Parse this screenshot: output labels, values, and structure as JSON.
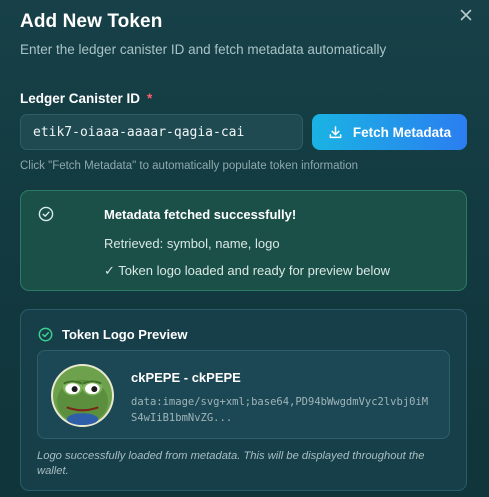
{
  "dialog": {
    "title": "Add New Token",
    "subtitle": "Enter the ledger canister ID and fetch metadata automatically",
    "close_icon": "close-icon"
  },
  "ledger_field": {
    "label": "Ledger Canister ID",
    "required_mark": "*",
    "value": "etik7-oiaaa-aaaar-qagia-cai",
    "hint": "Click \"Fetch Metadata\" to automatically populate token information"
  },
  "fetch_button": {
    "label": "Fetch Metadata",
    "icon": "download-icon"
  },
  "success": {
    "icon": "check-circle-icon",
    "title": "Metadata fetched successfully!",
    "retrieved": "Retrieved: symbol, name, logo",
    "logo_status": "✓ Token logo loaded and ready for preview below"
  },
  "preview": {
    "icon": "check-circle-icon",
    "title": "Token Logo Preview",
    "token_label": "ckPEPE - ckPEPE",
    "logo_data": "data:image/svg+xml;base64,PD94bWwgdmVyc2lvbj0iMS4wIiB1bmNvZG...",
    "note": "Logo successfully loaded from metadata. This will be displayed throughout the wallet."
  },
  "colors": {
    "accent_start": "#1ab3e3",
    "accent_end": "#2b7ef0",
    "success_border": "#2b7a64",
    "required": "#ff5d6c"
  }
}
